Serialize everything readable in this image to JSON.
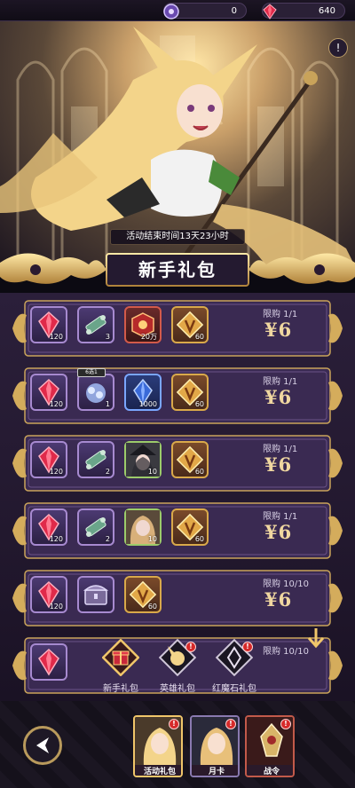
{
  "currencies": [
    {
      "icon": "purple-orb-icon",
      "value": "0"
    },
    {
      "icon": "red-gem-icon",
      "value": "640"
    }
  ],
  "event_timer": "活动结束时间13天23小时",
  "banner_title": "新手礼包",
  "colors": {
    "accent_gold": "#f0d7a0",
    "panel_purple": "#2b1f3a",
    "badge_red": "#d62a2a"
  },
  "packs": [
    {
      "limit": "限购 1/1",
      "price": "¥6",
      "items": [
        {
          "icon": "red-gem-icon",
          "qty": "120"
        },
        {
          "icon": "scroll-icon",
          "qty": "3"
        },
        {
          "icon": "red-token-icon",
          "qty": "20万"
        },
        {
          "icon": "gold-v-card-icon",
          "qty": "60"
        }
      ]
    },
    {
      "limit": "限购 1/1",
      "price": "¥6",
      "items": [
        {
          "icon": "red-gem-icon",
          "qty": "120"
        },
        {
          "icon": "blue-crystal-cluster-icon",
          "qty": "1",
          "badge": "6选1"
        },
        {
          "icon": "blue-crystal-icon",
          "qty": "1000"
        },
        {
          "icon": "gold-v-card-icon",
          "qty": "60"
        }
      ]
    },
    {
      "limit": "限购 1/1",
      "price": "¥6",
      "items": [
        {
          "icon": "red-gem-icon",
          "qty": "120"
        },
        {
          "icon": "scroll-icon",
          "qty": "2"
        },
        {
          "icon": "hero-portrait-witch-icon",
          "qty": "10"
        },
        {
          "icon": "gold-v-card-icon",
          "qty": "60"
        }
      ]
    },
    {
      "limit": "限购 1/1",
      "price": "¥6",
      "items": [
        {
          "icon": "red-gem-icon",
          "qty": "120"
        },
        {
          "icon": "scroll-icon",
          "qty": "2"
        },
        {
          "icon": "hero-portrait-girl-icon",
          "qty": "10"
        },
        {
          "icon": "gold-v-card-icon",
          "qty": "60"
        }
      ]
    },
    {
      "limit": "限购 10/10",
      "price": "¥6",
      "items": [
        {
          "icon": "red-gem-icon",
          "qty": "120"
        },
        {
          "icon": "treasure-chest-icon",
          "qty": ""
        },
        {
          "icon": "gold-v-card-icon",
          "qty": "60"
        }
      ]
    },
    {
      "limit": "限购 10/10",
      "price": "",
      "items": [
        {
          "icon": "red-gem-icon",
          "qty": ""
        }
      ]
    }
  ],
  "tabs": [
    {
      "label": "新手礼包",
      "icon": "gift-icon",
      "badge": "",
      "selected": true
    },
    {
      "label": "英雄礼包",
      "icon": "hero-head-icon",
      "badge": "!",
      "selected": false
    },
    {
      "label": "红魔石礼包",
      "icon": "red-stone-icon",
      "badge": "!",
      "selected": false
    }
  ],
  "bottom_nav": [
    {
      "label": "活动礼包",
      "badge": "!",
      "icon": "elf-portrait-icon"
    },
    {
      "label": "月卡",
      "badge": "!",
      "icon": "girl-portrait-icon"
    },
    {
      "label": "战令",
      "badge": "!",
      "icon": "emblem-icon"
    }
  ]
}
